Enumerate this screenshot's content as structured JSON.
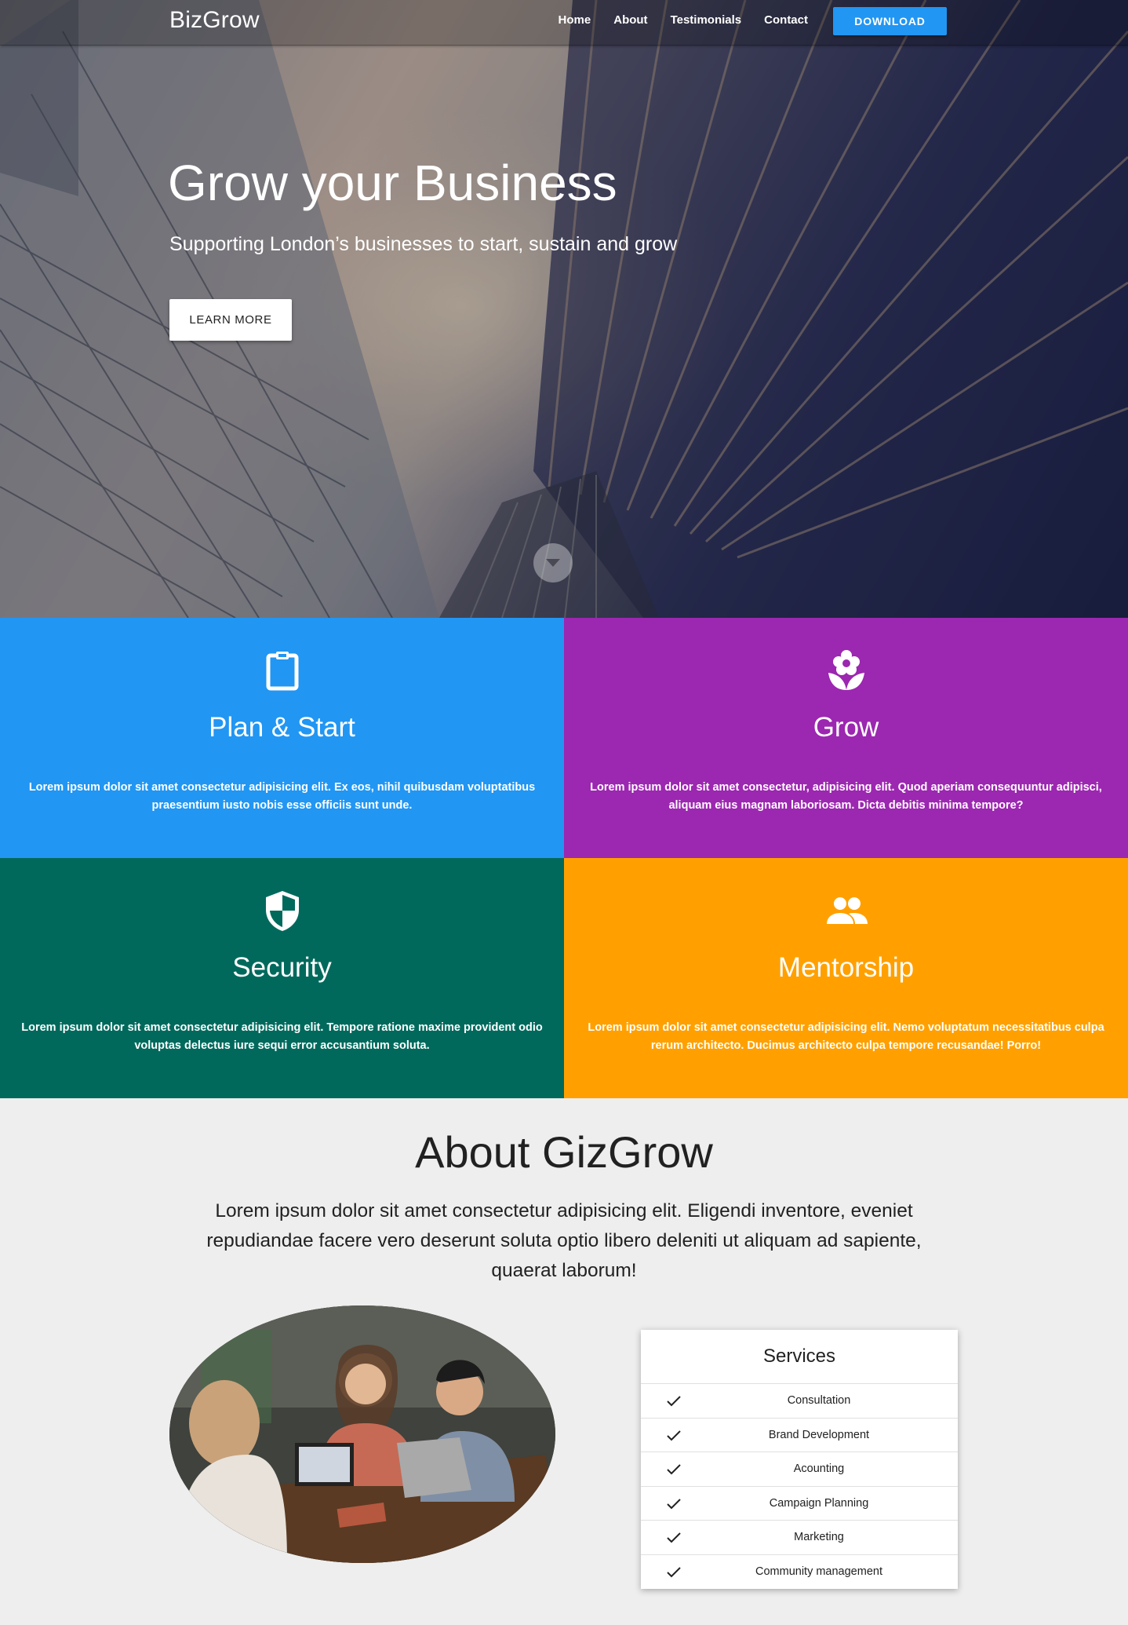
{
  "navbar": {
    "brand": "BizGrow",
    "links": [
      "Home",
      "About",
      "Testimonials",
      "Contact"
    ],
    "download_label": "DOWNLOAD"
  },
  "hero": {
    "title": "Grow your Business",
    "subtitle": "Supporting London’s businesses to start, sustain and grow",
    "cta_label": "LEARN MORE",
    "scroll_icon": "caret-down-icon"
  },
  "features": [
    {
      "icon": "clipboard-icon",
      "title": "Plan & Start",
      "text": "Lorem ipsum dolor sit amet consectetur adipisicing elit. Ex eos, nihil quibusdam voluptatibus praesentium iusto nobis esse officiis sunt unde.",
      "color": "#2196f3"
    },
    {
      "icon": "flower-icon",
      "title": "Grow",
      "text": "Lorem ipsum dolor sit amet consectetur, adipisicing elit. Quod aperiam consequuntur adipisci, aliquam eius magnam laboriosam. Dicta debitis minima tempore?",
      "color": "#9c27b0"
    },
    {
      "icon": "shield-icon",
      "title": "Security",
      "text": "Lorem ipsum dolor sit amet consectetur adipisicing elit. Tempore ratione maxime provident odio voluptas delectus iure sequi error accusantium soluta.",
      "color": "#00695c"
    },
    {
      "icon": "people-icon",
      "title": "Mentorship",
      "text": "Lorem ipsum dolor sit amet consectetur adipisicing elit. Nemo voluptatum necessitatibus culpa rerum architecto. Ducimus architecto culpa tempore recusandae! Porro!",
      "color": "#ffa000"
    }
  ],
  "about": {
    "title": "About GizGrow",
    "text": "Lorem ipsum dolor sit amet consectetur adipisicing elit. Eligendi inventore, eveniet repudiandae facere vero deserunt soluta optio libero deleniti ut aliquam ad sapiente, quaerat laborum!"
  },
  "services": {
    "title": "Services",
    "items": [
      "Consultation",
      "Brand Development",
      "Acounting",
      "Campaign Planning",
      "Marketing",
      "Community management"
    ]
  },
  "colors": {
    "accent": "#2196f3",
    "purple": "#9c27b0",
    "teal": "#00695c",
    "amber": "#ffa000",
    "page_bg": "#eeeeee"
  }
}
